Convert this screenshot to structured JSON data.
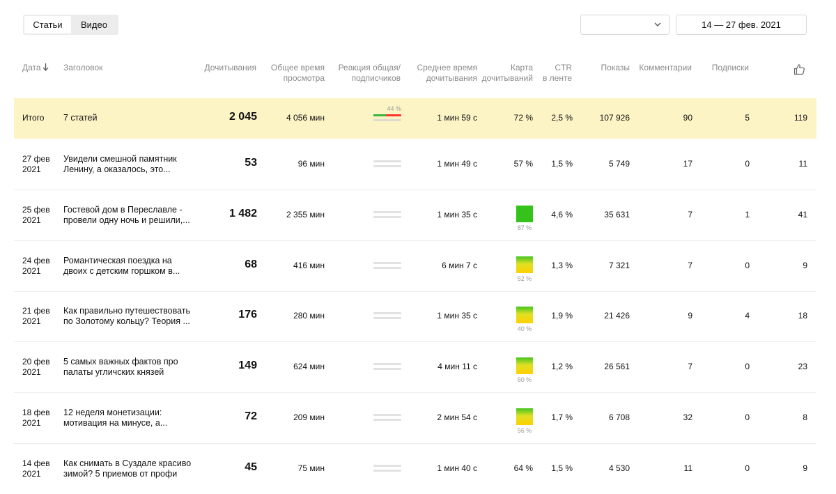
{
  "tabs": [
    {
      "label": "Статьи",
      "active": true
    },
    {
      "label": "Видео",
      "active": false
    }
  ],
  "filter": {
    "selected": ""
  },
  "date_range": "14 — 27 фев. 2021",
  "columns": {
    "date": "Дата",
    "title": "Заголовок",
    "reads": "Дочитывания",
    "view_time_1": "Общее время",
    "view_time_2": "просмотра",
    "reaction_1": "Реакция общая/",
    "reaction_2": "подписчиков",
    "avg_time_1": "Среднее время",
    "avg_time_2": "дочитывания",
    "map_1": "Карта",
    "map_2": "дочитываний",
    "ctr_1": "CTR",
    "ctr_2": "в ленте",
    "shows": "Показы",
    "comments": "Комментарии",
    "subs": "Подписки",
    "likes_icon": "thumbs-up-icon"
  },
  "total": {
    "label": "Итого",
    "title": "7 статей",
    "reads": "2 045",
    "view_time": "4 056 мин",
    "reaction_pct": "44 %",
    "reaction_fraction": 0.44,
    "avg_time": "1 мин 59 с",
    "map": "72 %",
    "ctr": "2,5 %",
    "shows": "107 926",
    "comments": "90",
    "subs": "5",
    "likes": "119"
  },
  "rows": [
    {
      "date1": "27 фев",
      "date2": "2021",
      "title1": "Увидели смешной памятник",
      "title2": "Ленину, а оказалось, это...",
      "reads": "53",
      "view_time": "96 мин",
      "avg_time": "1 мин 49 с",
      "map": "57 %",
      "map_kind": "text",
      "ctr": "1,5 %",
      "shows": "5 749",
      "comments": "17",
      "subs": "0",
      "likes": "11"
    },
    {
      "date1": "25 фев",
      "date2": "2021",
      "title1": "Гостевой дом в Переславле -",
      "title2": "провели одну ночь и решили,...",
      "reads": "1 482",
      "view_time": "2 355 мин",
      "avg_time": "1 мин 35 с",
      "map": "87 %",
      "map_kind": "green",
      "ctr": "4,6 %",
      "shows": "35 631",
      "comments": "7",
      "subs": "1",
      "likes": "41"
    },
    {
      "date1": "24 фев",
      "date2": "2021",
      "title1": "Романтическая поездка на",
      "title2": "двоих с детским горшком в...",
      "reads": "68",
      "view_time": "416 мин",
      "avg_time": "6 мин 7 с",
      "map": "52 %",
      "map_kind": "yellow",
      "ctr": "1,3 %",
      "shows": "7 321",
      "comments": "7",
      "subs": "0",
      "likes": "9"
    },
    {
      "date1": "21 фев",
      "date2": "2021",
      "title1": "Как правильно путешествовать",
      "title2": "по Золотому кольцу? Теория ...",
      "reads": "176",
      "view_time": "280 мин",
      "avg_time": "1 мин 35 с",
      "map": "40 %",
      "map_kind": "yellow",
      "ctr": "1,9 %",
      "shows": "21 426",
      "comments": "9",
      "subs": "4",
      "likes": "18"
    },
    {
      "date1": "20 фев",
      "date2": "2021",
      "title1": "5 самых важных фактов про",
      "title2": "палаты угличских князей",
      "reads": "149",
      "view_time": "624 мин",
      "avg_time": "4 мин 11 с",
      "map": "50 %",
      "map_kind": "yellow",
      "ctr": "1,2 %",
      "shows": "26 561",
      "comments": "7",
      "subs": "0",
      "likes": "23"
    },
    {
      "date1": "18 фев",
      "date2": "2021",
      "title1": "12 неделя монетизации:",
      "title2": "мотивация на минусе, а...",
      "reads": "72",
      "view_time": "209 мин",
      "avg_time": "2 мин 54 с",
      "map": "56 %",
      "map_kind": "yellow",
      "ctr": "1,7 %",
      "shows": "6 708",
      "comments": "32",
      "subs": "0",
      "likes": "8"
    },
    {
      "date1": "14 фев",
      "date2": "2021",
      "title1": "Как снимать в Суздале красиво",
      "title2": "зимой? 5 приемов от профи",
      "reads": "45",
      "view_time": "75 мин",
      "avg_time": "1 мин 40 с",
      "map": "64 %",
      "map_kind": "text",
      "ctr": "1,5 %",
      "shows": "4 530",
      "comments": "11",
      "subs": "0",
      "likes": "9"
    }
  ]
}
